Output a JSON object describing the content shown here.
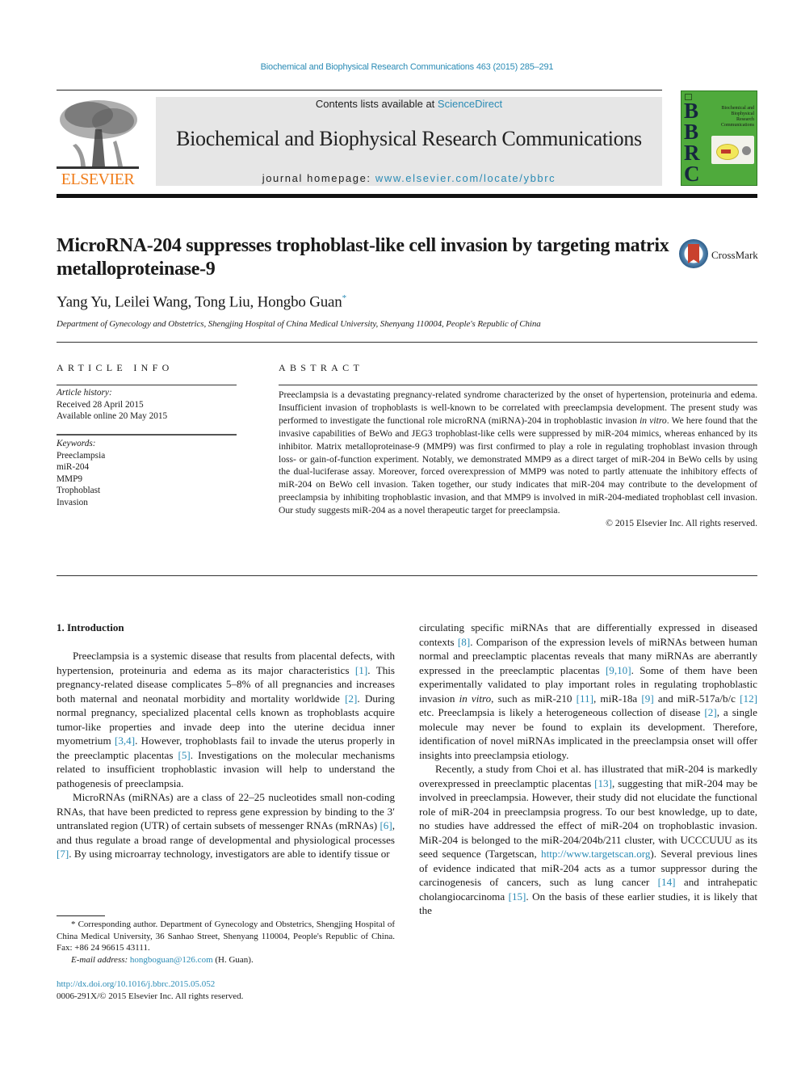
{
  "header": {
    "citation": "Biochemical and Biophysical Research Communications 463 (2015) 285–291",
    "contents_prefix": "Contents lists available at ",
    "contents_link": "ScienceDirect",
    "journal_title": "Biochemical and Biophysical Research Communications",
    "homepage_prefix": "journal homepage: ",
    "homepage_link": "www.elsevier.com/locate/ybbrc",
    "publisher_logo_text": "ELSEVIER",
    "cover": {
      "letters": [
        "B",
        "B",
        "R",
        "C"
      ],
      "title_lines": [
        "Biochemical and",
        "Biophysical",
        "Research",
        "Communications"
      ],
      "color": "#4faa3c"
    }
  },
  "article": {
    "title": "MicroRNA-204 suppresses trophoblast-like cell invasion by targeting matrix metalloproteinase-9",
    "crossmark_label": "CrossMark",
    "authors": "Yang Yu, Leilei Wang, Tong Liu, Hongbo Guan",
    "corresponding_mark": "*",
    "affiliation": "Department of Gynecology and Obstetrics, Shengjing Hospital of China Medical University, Shenyang 110004, People's Republic of China"
  },
  "article_info": {
    "heading": "ARTICLE INFO",
    "history_label": "Article history:",
    "received": "Received 28 April 2015",
    "available": "Available online 20 May 2015",
    "keywords_label": "Keywords:",
    "keywords": [
      "Preeclampsia",
      "miR-204",
      "MMP9",
      "Trophoblast",
      "Invasion"
    ]
  },
  "abstract": {
    "heading": "ABSTRACT",
    "text_1": "Preeclampsia is a devastating pregnancy-related syndrome characterized by the onset of hypertension, proteinuria and edema. Insufficient invasion of trophoblasts is well-known to be correlated with preeclampsia development. The present study was performed to investigate the functional role microRNA (miRNA)-204 in trophoblastic invasion ",
    "text_italic": "in vitro",
    "text_2": ". We here found that the invasive capabilities of BeWo and JEG3 trophoblast-like cells were suppressed by miR-204 mimics, whereas enhanced by its inhibitor. Matrix metalloproteinase-9 (MMP9) was first confirmed to play a role in regulating trophoblast invasion through loss- or gain-of-function experiment. Notably, we demonstrated MMP9 as a direct target of miR-204 in BeWo cells by using the dual-luciferase assay. Moreover, forced overexpression of MMP9 was noted to partly attenuate the inhibitory effects of miR-204 on BeWo cell invasion. Taken together, our study indicates that miR-204 may contribute to the development of preeclampsia by inhibiting trophoblastic invasion, and that MMP9 is involved in miR-204-mediated trophoblast cell invasion. Our study suggests miR-204 as a novel therapeutic target for preeclampsia.",
    "copyright": "© 2015 Elsevier Inc. All rights reserved."
  },
  "introduction": {
    "heading": "1.  Introduction",
    "left_p1": [
      "Preeclampsia is a systemic disease that results from placental defects, with hypertension, proteinuria and edema as its major characteristics ",
      "[1]",
      ". This pregnancy-related disease complicates 5–8% of all pregnancies and increases both maternal and neonatal morbidity and mortality worldwide ",
      "[2]",
      ". During normal pregnancy, specialized placental cells known as trophoblasts acquire tumor-like properties and invade deep into the uterine decidua inner myometrium ",
      "[3,4]",
      ". However, trophoblasts fail to invade the uterus properly in the preeclamptic placentas ",
      "[5]",
      ". Investigations on the molecular mechanisms related to insufficient trophoblastic invasion will help to understand the pathogenesis of preeclampsia."
    ],
    "left_p2": [
      "MicroRNAs (miRNAs) are a class of 22–25 nucleotides small non-coding RNAs, that have been predicted to repress gene expression by binding to the 3′ untranslated region (UTR) of certain subsets of messenger RNAs (mRNAs) ",
      "[6]",
      ", and thus regulate a broad range of developmental and physiological processes ",
      "[7]",
      ". By using microarray technology, investigators are able to identify tissue or"
    ],
    "right_p1": [
      "circulating specific miRNAs that are differentially expressed in diseased contexts ",
      "[8]",
      ". Comparison of the expression levels of miRNAs between human normal and preeclamptic placentas reveals that many miRNAs are aberrantly expressed in the preeclamptic placentas ",
      "[9,10]",
      ". Some of them have been experimentally validated to play important roles in regulating trophoblastic invasion ",
      "in vitro",
      ", such as miR-210 ",
      "[11]",
      ", miR-18a ",
      "[9]",
      " and miR-517a/b/c ",
      "[12]",
      " etc. Preeclampsia is likely a heterogeneous collection of disease ",
      "[2]",
      ", a single molecule may never be found to explain its development. Therefore, identification of novel miRNAs implicated in the preeclampsia onset will offer insights into preeclampsia etiology."
    ],
    "right_p2": [
      "Recently, a study from Choi et al. has illustrated that miR-204 is markedly overexpressed in preeclamptic placentas ",
      "[13]",
      ", suggesting that miR-204 may be involved in preeclampsia. However, their study did not elucidate the functional role of miR-204 in preeclampsia progress. To our best knowledge, up to date, no studies have addressed the effect of miR-204 on trophoblastic invasion. MiR-204 is belonged to the miR-204/204b/211 cluster, with UCCCUUU as its seed sequence (Targetscan, ",
      "http://www.targetscan.org",
      "). Several previous lines of evidence indicated that miR-204 acts as a tumor suppressor during the carcinogenesis of cancers, such as lung cancer ",
      "[14]",
      " and intrahepatic cholangiocarcinoma ",
      "[15]",
      ". On the basis of these earlier studies, it is likely that the"
    ]
  },
  "footnote": {
    "corresponding": "* Corresponding author. Department of Gynecology and Obstetrics, Shengjing Hospital of China Medical University, 36 Sanhao Street, Shenyang 110004, People's Republic of China. Fax: +86 24 96615 43111.",
    "email_label": "E-mail address: ",
    "email": "hongboguan@126.com",
    "email_suffix": " (H. Guan).",
    "doi": "http://dx.doi.org/10.1016/j.bbrc.2015.05.052",
    "issn": "0006-291X/© 2015 Elsevier Inc. All rights reserved."
  },
  "colors": {
    "link": "#2a8bb5",
    "elsevier_orange": "#f07d1b",
    "masthead_bg": "#e6e6e6"
  }
}
